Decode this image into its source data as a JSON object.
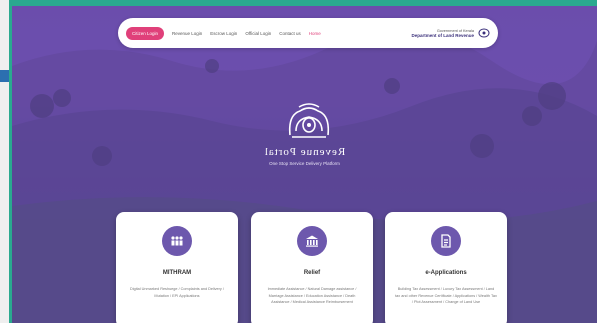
{
  "nav": {
    "login_label": "Citizen Login",
    "links": [
      "Revenue Login",
      "Escrow Login",
      "Official Login",
      "Contact us",
      "Home"
    ],
    "brand_small": "Government of Kerala",
    "brand_main": "Department of Land Revenue"
  },
  "hero": {
    "title": "Revenue Portal",
    "subtitle": "One Stop Service Delivery Platform"
  },
  "cards": [
    {
      "title": "MITHRAM",
      "desc": "Digital Unmarked Reshuege / Complaints and Delivery / Mutation / EPI Applications",
      "icon": "people-icon"
    },
    {
      "title": "Relief",
      "desc": "Immediate Assistance / Natural Damage assistance / Marriage Assistance / Education Assistance / Death Assistance / Medical Assistance Reimbursement",
      "icon": "bank-icon"
    },
    {
      "title": "e-Applications",
      "desc": "Building Tax Assessment / Luxury Tax Assessment / Land tax and other Revenue Certificate / Applications / Wealth Tax / Plot Assessment / Change of Land Use",
      "icon": "document-icon"
    }
  ]
}
